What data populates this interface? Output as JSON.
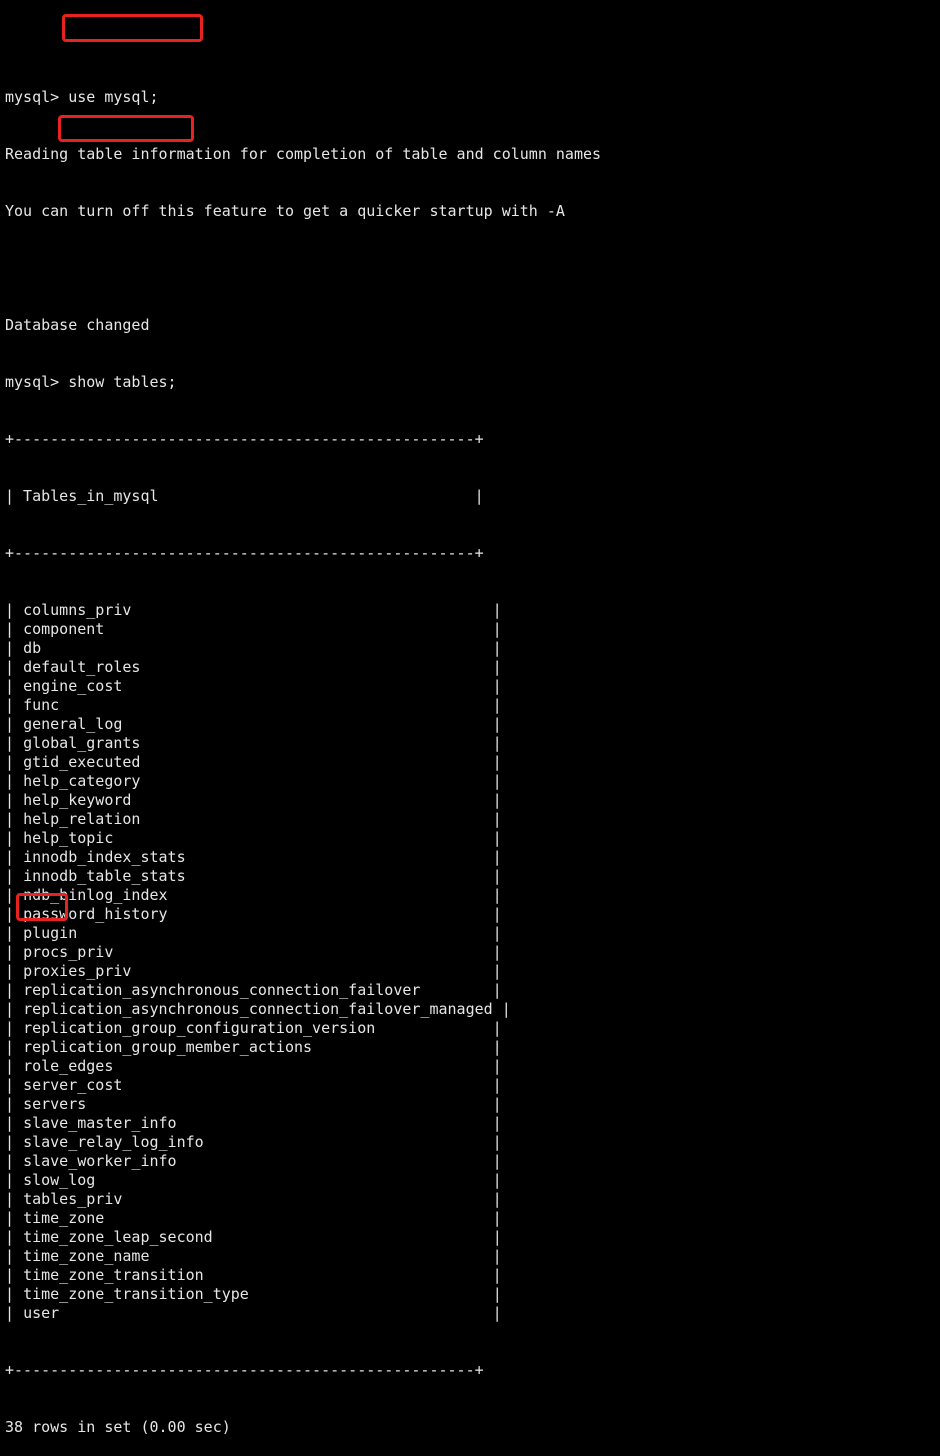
{
  "terminal": {
    "prompt": "mysql> ",
    "cmd_use": "use mysql;",
    "msg_reading": "Reading table information for completion of table and column names",
    "msg_turn_off": "You can turn off this feature to get a quicker startup with -A",
    "msg_db_changed": "Database changed",
    "cmd_show": "show tables;",
    "table_border": "+---------------------------------------------------+",
    "table_header": "| Tables_in_mysql                                   |",
    "rows": [
      "columns_priv",
      "component",
      "db",
      "default_roles",
      "engine_cost",
      "func",
      "general_log",
      "global_grants",
      "gtid_executed",
      "help_category",
      "help_keyword",
      "help_relation",
      "help_topic",
      "innodb_index_stats",
      "innodb_table_stats",
      "ndb_binlog_index",
      "password_history",
      "plugin",
      "procs_priv",
      "proxies_priv",
      "replication_asynchronous_connection_failover",
      "replication_asynchronous_connection_failover_managed",
      "replication_group_configuration_version",
      "replication_group_member_actions",
      "role_edges",
      "server_cost",
      "servers",
      "slave_master_info",
      "slave_relay_log_info",
      "slave_worker_info",
      "slow_log",
      "tables_priv",
      "time_zone",
      "time_zone_leap_second",
      "time_zone_name",
      "time_zone_transition",
      "time_zone_transition_type",
      "user"
    ],
    "summary": "38 rows in set (0.00 sec)"
  },
  "colors": {
    "background": "#000000",
    "text": "#e6e6e6",
    "highlight": "#e8231f"
  }
}
